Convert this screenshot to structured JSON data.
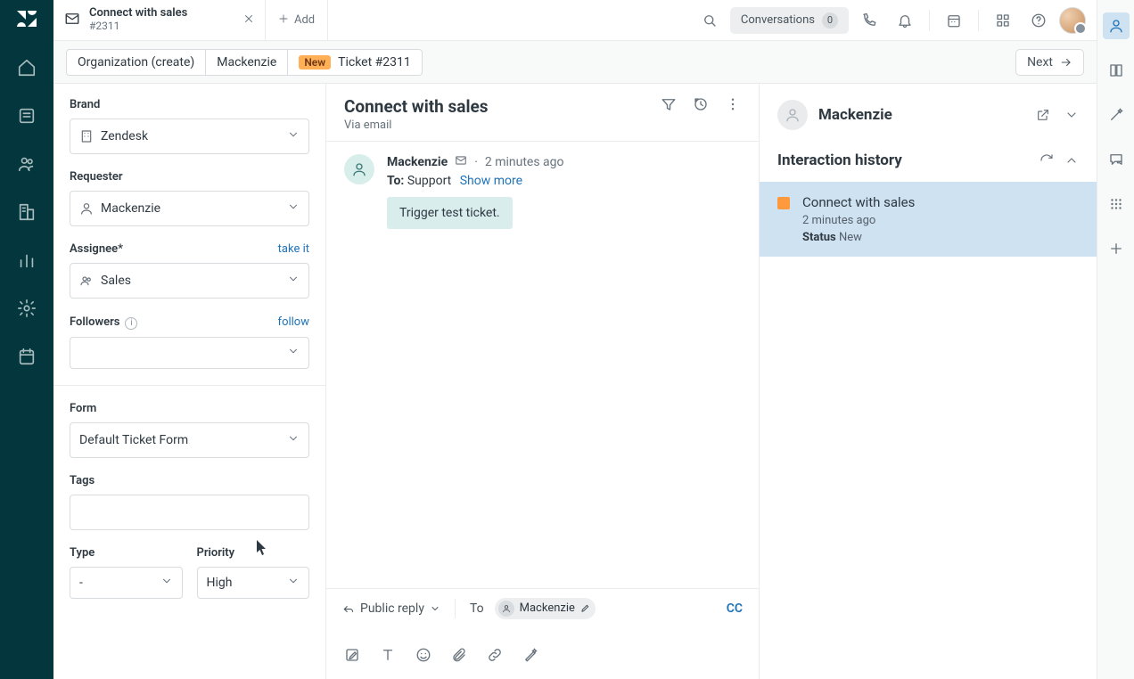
{
  "topbar": {
    "tab": {
      "title": "Connect with sales",
      "sub": "#2311"
    },
    "add_label": "Add",
    "conversations_label": "Conversations",
    "conversations_count": "0"
  },
  "crumbs": {
    "org": "Organization (create)",
    "user": "Mackenzie",
    "new_badge": "New",
    "ticket": "Ticket #2311",
    "next": "Next"
  },
  "sidebar": {
    "brand_label": "Brand",
    "brand_value": "Zendesk",
    "requester_label": "Requester",
    "requester_value": "Mackenzie",
    "assignee_label": "Assignee*",
    "take_it": "take it",
    "assignee_value": "Sales",
    "followers_label": "Followers",
    "follow": "follow",
    "form_label": "Form",
    "form_value": "Default Ticket Form",
    "tags_label": "Tags",
    "type_label": "Type",
    "type_value": "-",
    "priority_label": "Priority",
    "priority_value": "High"
  },
  "ticket": {
    "title": "Connect with sales",
    "via": "Via email",
    "msg_name": "Mackenzie",
    "msg_time": "2 minutes ago",
    "to_label": "To:",
    "to_value": "Support",
    "show_more": "Show more",
    "body": "Trigger test ticket."
  },
  "reply": {
    "mode": "Public reply",
    "to_label": "To",
    "recipient": "Mackenzie",
    "cc": "CC"
  },
  "context": {
    "name": "Mackenzie",
    "history_title": "Interaction history",
    "item_title": "Connect with sales",
    "item_time": "2 minutes ago",
    "item_status_label": "Status",
    "item_status_value": "New"
  }
}
